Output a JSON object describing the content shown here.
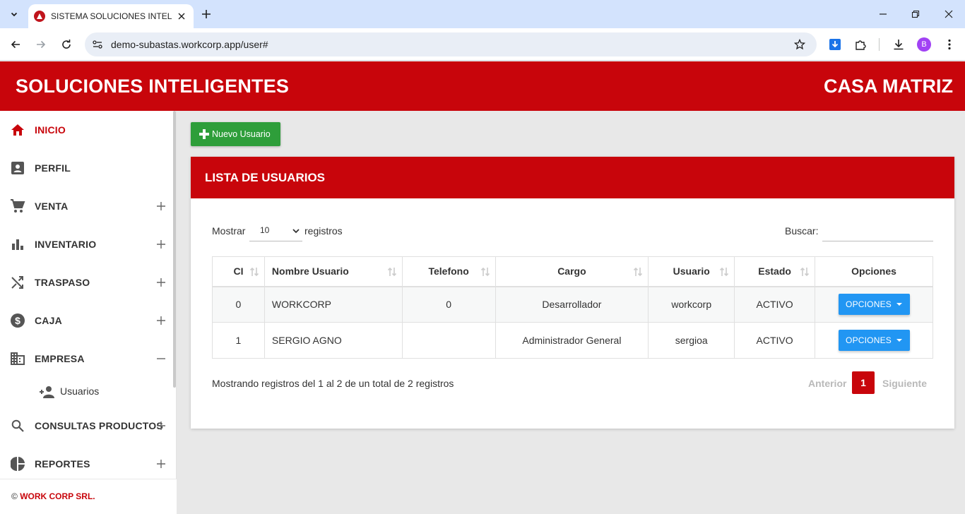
{
  "browser": {
    "tab_title": "SISTEMA SOLUCIONES INTELIGENTES",
    "url": "demo-subastas.workcorp.app/user#",
    "profile_initial": "B"
  },
  "header": {
    "brand": "SOLUCIONES INTELIGENTES",
    "branch": "CASA MATRIZ"
  },
  "sidebar": {
    "items": [
      {
        "label": "INICIO",
        "icon": "home-icon",
        "expand": ""
      },
      {
        "label": "PERFIL",
        "icon": "account-box-icon",
        "expand": ""
      },
      {
        "label": "VENTA",
        "icon": "cart-icon",
        "expand": "+"
      },
      {
        "label": "INVENTARIO",
        "icon": "bar-chart-icon",
        "expand": "+"
      },
      {
        "label": "TRASPASO",
        "icon": "shuffle-icon",
        "expand": "+"
      },
      {
        "label": "CAJA",
        "icon": "dollar-icon",
        "expand": "+"
      },
      {
        "label": "EMPRESA",
        "icon": "building-icon",
        "expand": "−"
      },
      {
        "label": "CONSULTAS PRODUCTOS",
        "icon": "search-icon",
        "expand": "+"
      },
      {
        "label": "REPORTES",
        "icon": "pie-chart-icon",
        "expand": "+"
      }
    ],
    "sub_item": {
      "label": "Usuarios",
      "icon": "person-add-icon"
    },
    "footer_prefix": "© ",
    "footer_company": "WORK CORP SRL."
  },
  "main": {
    "new_user_label": "Nuevo Usuario",
    "card_title": "LISTA DE USUARIOS",
    "length": {
      "show_label": "Mostrar",
      "value": "10",
      "records_label": "registros"
    },
    "search_label": "Buscar:",
    "search_value": "",
    "columns": [
      "CI",
      "Nombre Usuario",
      "Telefono",
      "Cargo",
      "Usuario",
      "Estado",
      "Opciones"
    ],
    "rows": [
      {
        "ci": "0",
        "name": "WORKCORP",
        "phone": "0",
        "role": "Desarrollador",
        "user": "workcorp",
        "status": "ACTIVO",
        "action": "OPCIONES"
      },
      {
        "ci": "1",
        "name": "SERGIO AGNO",
        "phone": "",
        "role": "Administrador General",
        "user": "sergioa",
        "status": "ACTIVO",
        "action": "OPCIONES"
      }
    ],
    "info": "Mostrando registros del 1 al 2 de un total de 2 registros",
    "pagination": {
      "prev": "Anterior",
      "current": "1",
      "next": "Siguiente"
    }
  },
  "colors": {
    "brand_red": "#c8050b",
    "success_green": "#2e9e3a",
    "button_blue": "#2196f3"
  }
}
